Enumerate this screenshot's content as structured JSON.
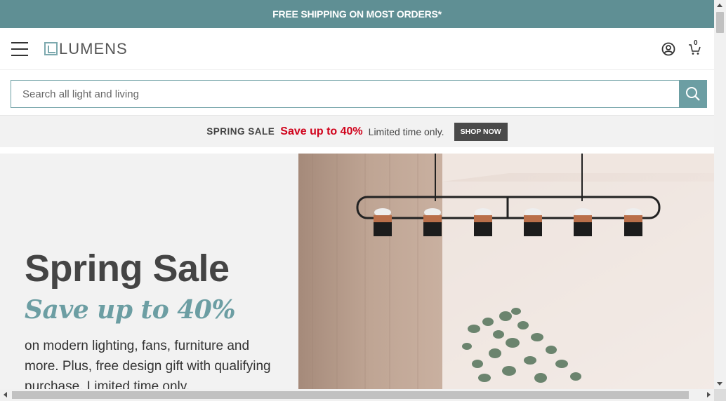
{
  "promo": {
    "text": "FREE SHIPPING ON MOST ORDERS*"
  },
  "header": {
    "menu_icon": "hamburger-menu-icon",
    "logo_text": "LUMENS",
    "account_icon": "account-icon",
    "cart_icon": "cart-icon",
    "cart_count": "0"
  },
  "search": {
    "placeholder": "Search all light and living",
    "icon": "search-icon"
  },
  "sale_strip": {
    "label": "SPRING SALE",
    "amount": "Save up to 40%",
    "note": "Limited time only.",
    "cta": "SHOP NOW"
  },
  "hero": {
    "title": "Spring Sale",
    "subtitle": "Save up to 40%",
    "body": "on modern lighting, fans, furniture and more. Plus, free design gift with qualifying purchase. Limited time only."
  },
  "colors": {
    "accent": "#6c9ea3",
    "promo_bg": "#5f8f94",
    "sale_red": "#d0021b",
    "button_dark": "#4a4a4a"
  }
}
